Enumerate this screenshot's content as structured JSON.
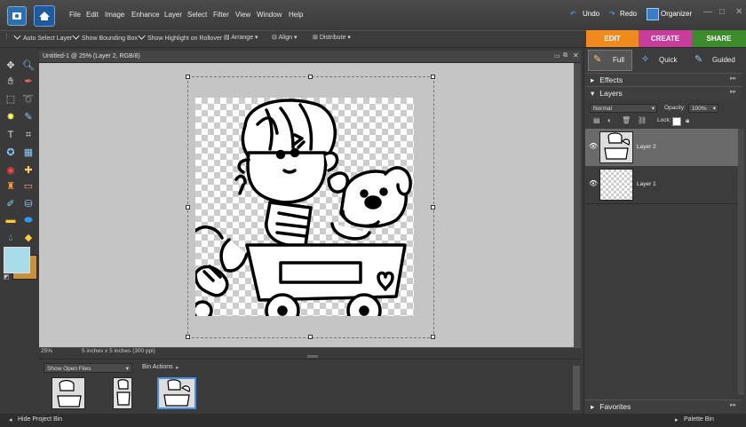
{
  "menu": [
    "File",
    "Edit",
    "Image",
    "Enhance",
    "Layer",
    "Select",
    "Filter",
    "View",
    "Window",
    "Help"
  ],
  "top_right": {
    "undo": "Undo",
    "redo": "Redo",
    "organizer": "Organizer"
  },
  "window_controls": {
    "minimize": "—",
    "restore": "□",
    "close": "✕"
  },
  "options": {
    "auto_select_layer": "Auto Select Layer",
    "show_bounding_box": "Show Bounding Box",
    "show_highlight": "Show Highlight on Rollover",
    "arrange": "Arrange",
    "align": "Align",
    "distribute": "Distribute"
  },
  "mode_tabs": {
    "edit": "EDIT",
    "create": "CREATE",
    "share": "SHARE"
  },
  "document": {
    "title": "Untitled-1 @ 25% (Layer 2, RGB/8)",
    "zoom": "25%",
    "size_info": "5 inches x 5 inches (300 ppi)"
  },
  "project_bin": {
    "dropdown": "Show Open Files",
    "actions": "Bin Actions"
  },
  "bottom": {
    "hide_bin": "Hide Project Bin",
    "palette_bin": "Palette Bin"
  },
  "right_panel": {
    "views": {
      "full": "Full",
      "quick": "Quick",
      "guided": "Guided"
    },
    "effects": "Effects",
    "layers": "Layers",
    "blend_mode": "Normal",
    "opacity_label": "Opacity:",
    "opacity_value": "100%",
    "lock_label": "Lock:",
    "layer_items": [
      {
        "name": "Layer 2",
        "selected": true
      },
      {
        "name": "Layer 1",
        "selected": false
      }
    ],
    "favorites": "Favorites"
  },
  "colors": {
    "foreground": "#a8dce8",
    "background": "#c8913c",
    "edit": "#f08a1c",
    "create": "#c83c9a",
    "share": "#3c8c2c"
  }
}
